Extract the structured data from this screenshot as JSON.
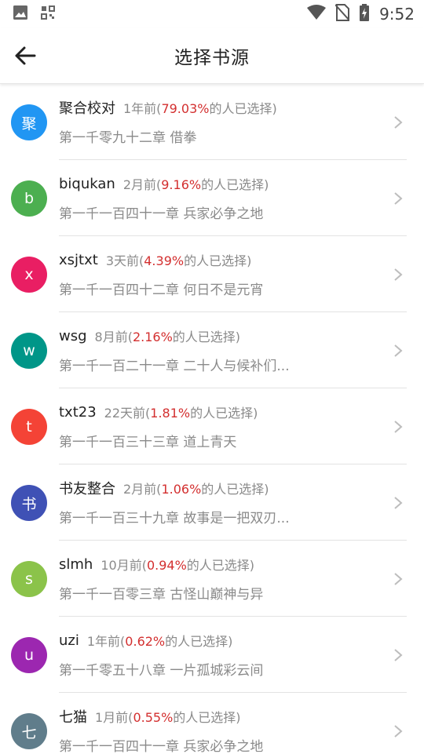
{
  "status_bar": {
    "time": "9:52",
    "icons": [
      "gallery-icon",
      "qr-icon",
      "wifi-icon",
      "no-sim-icon",
      "battery-charging-icon"
    ]
  },
  "header": {
    "title": "选择书源",
    "back_icon": "arrow-left-icon"
  },
  "colors": {
    "accent_percent": "#d32f2f",
    "avatars": [
      "#2196f3",
      "#4caf50",
      "#e91e63",
      "#009688",
      "#f44336",
      "#3f51b5",
      "#8bc34a",
      "#9c27b0",
      "#607d8b"
    ]
  },
  "sources": [
    {
      "initial": "聚",
      "name": "聚合校对",
      "time": "1年前(",
      "percent": "79.03%",
      "suffix": "的人已选择)",
      "chapter": "第一千零九十二章 借拳"
    },
    {
      "initial": "b",
      "name": "biqukan",
      "time": "2月前(",
      "percent": "9.16%",
      "suffix": "的人已选择)",
      "chapter": "第一千一百四十一章 兵家必争之地"
    },
    {
      "initial": "x",
      "name": "xsjtxt",
      "time": "3天前(",
      "percent": "4.39%",
      "suffix": "的人已选择)",
      "chapter": "第一千一百四十二章 何日不是元宵"
    },
    {
      "initial": "w",
      "name": "wsg",
      "time": "8月前(",
      "percent": "2.16%",
      "suffix": "的人已选择)",
      "chapter": "第一千一百二十一章 二十人与候补们..."
    },
    {
      "initial": "t",
      "name": "txt23",
      "time": "22天前(",
      "percent": "1.81%",
      "suffix": "的人已选择)",
      "chapter": "第一千一百三十三章 道上青天"
    },
    {
      "initial": "书",
      "name": "书友整合",
      "time": "2月前(",
      "percent": "1.06%",
      "suffix": "的人已选择)",
      "chapter": "第一千一百三十九章 故事是一把双刃..."
    },
    {
      "initial": "s",
      "name": "slmh",
      "time": "10月前(",
      "percent": "0.94%",
      "suffix": "的人已选择)",
      "chapter": "第一千一百零三章 古怪山巅神与异"
    },
    {
      "initial": "u",
      "name": "uzi",
      "time": "1年前(",
      "percent": "0.62%",
      "suffix": "的人已选择)",
      "chapter": "第一千零五十八章 一片孤城彩云间"
    },
    {
      "initial": "七",
      "name": "七猫",
      "time": "1月前(",
      "percent": "0.55%",
      "suffix": "的人已选择)",
      "chapter": "第一千一百四十一章 兵家必争之地"
    }
  ]
}
